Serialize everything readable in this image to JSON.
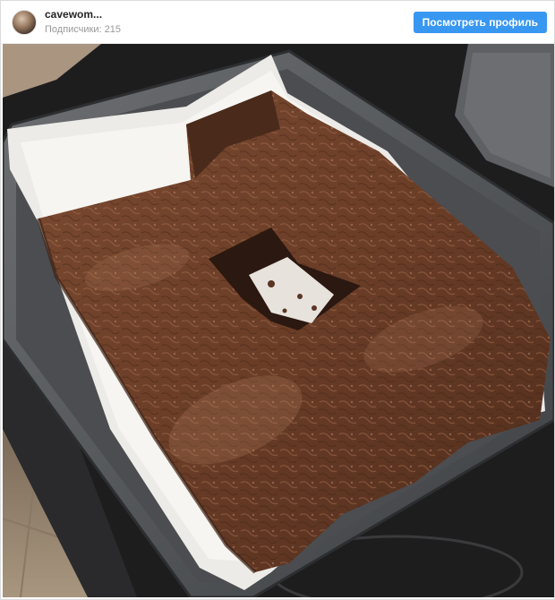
{
  "post": {
    "username": "cavewom...",
    "followers_label": "Подписчики: 215",
    "profile_button_label": "Посмотреть профиль"
  },
  "colors": {
    "accent": "#3897f0",
    "username": "#262626",
    "muted": "#999999"
  },
  "photo": {
    "subject": "brownie-in-baking-pan"
  }
}
